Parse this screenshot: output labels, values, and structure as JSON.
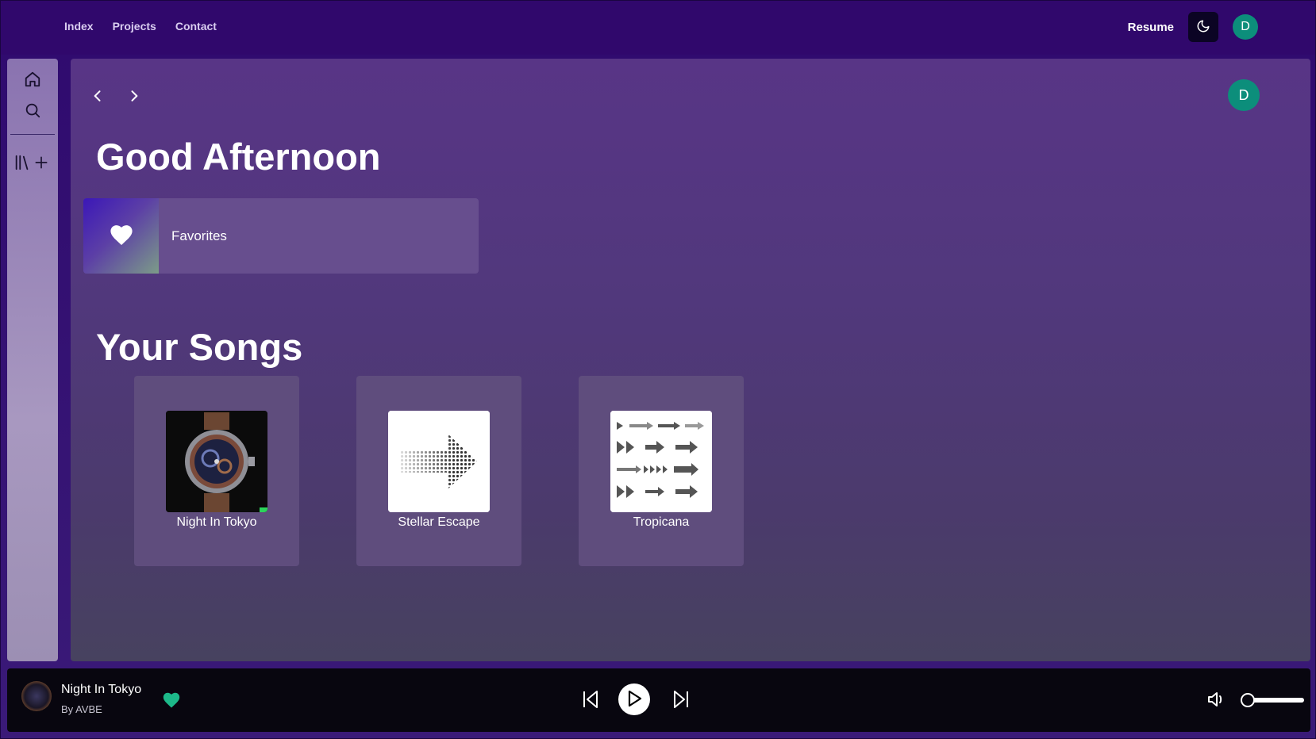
{
  "topnav": {
    "links": [
      "Index",
      "Projects",
      "Contact"
    ],
    "resume_label": "Resume",
    "avatar_initial": "D",
    "theme_icon": "moon-icon"
  },
  "sidebar": {
    "icons": [
      "home-icon",
      "search-icon",
      "library-icon",
      "plus-icon"
    ]
  },
  "main": {
    "avatar_initial": "D",
    "greeting": "Good Afternoon",
    "favorites": {
      "label": "Favorites",
      "icon": "heart-icon"
    },
    "songs_title": "Your Songs",
    "songs": [
      {
        "title": "Night In Tokyo",
        "art": "watch"
      },
      {
        "title": "Stellar Escape",
        "art": "arrow"
      },
      {
        "title": "Tropicana",
        "art": "arrows-grid"
      }
    ]
  },
  "player": {
    "title": "Night In Tokyo",
    "artist": "By AVBE",
    "liked": true,
    "accent": "#1db98a",
    "volume": 0.2
  }
}
